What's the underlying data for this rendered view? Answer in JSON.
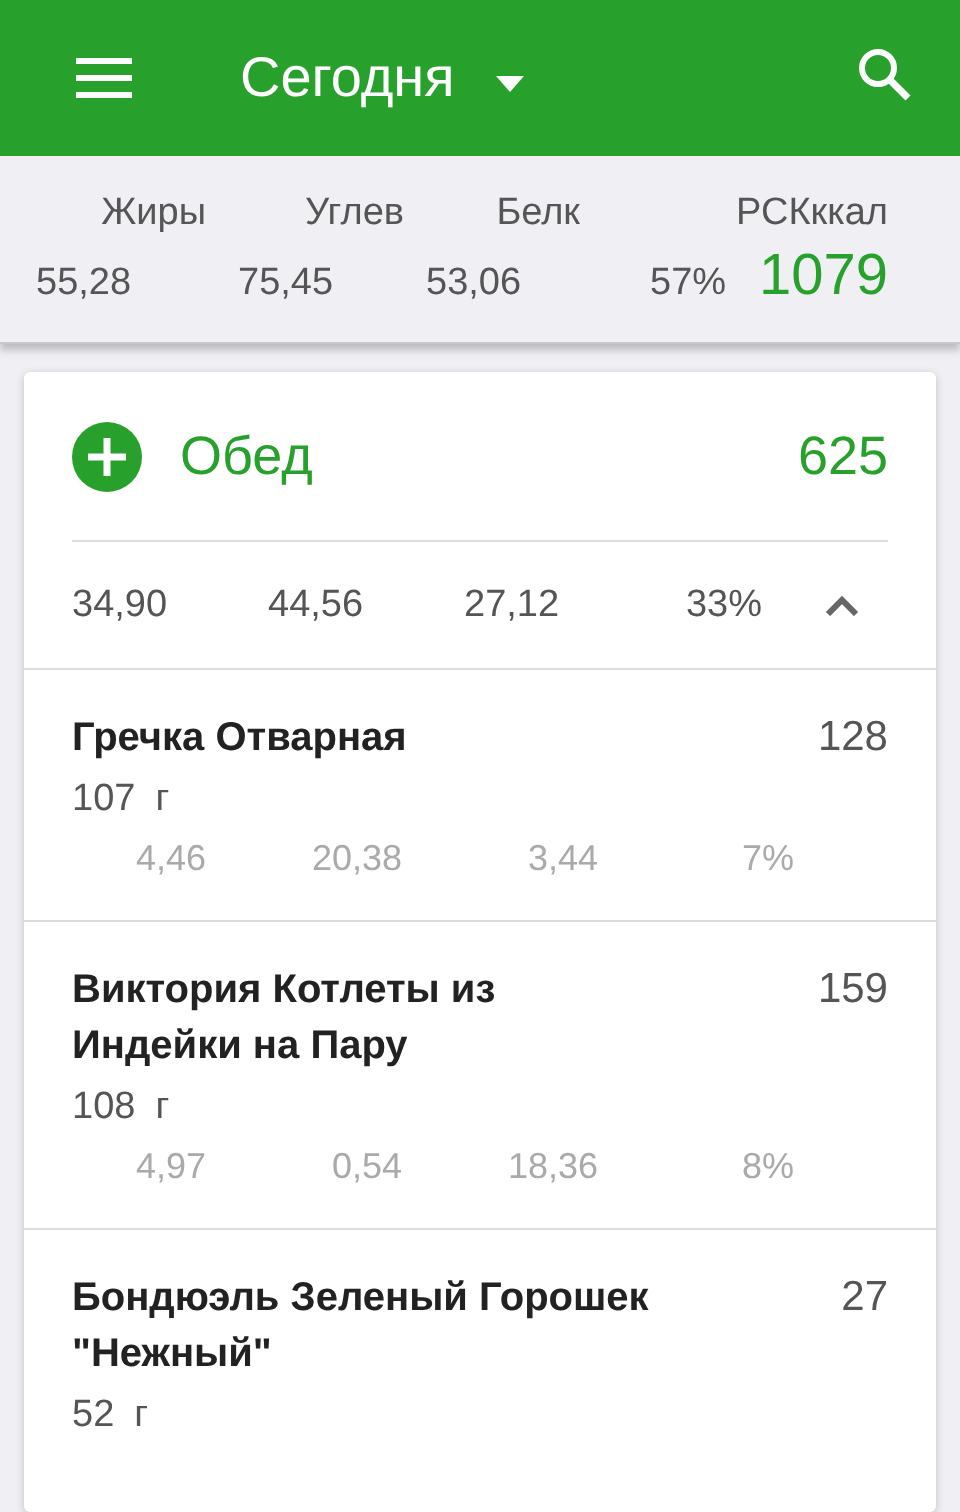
{
  "app_bar": {
    "title": "Сегодня"
  },
  "summary": {
    "labels": [
      "Жиры",
      "Углев",
      "Белк",
      "РСКккал"
    ],
    "values": [
      "55,28",
      "75,45",
      "53,06",
      "57%"
    ],
    "calories": "1079"
  },
  "meal": {
    "name": "Обед",
    "calories": "625",
    "expanded": true,
    "totals": [
      "34,90",
      "44,56",
      "27,12",
      "33%"
    ],
    "items": [
      {
        "name": "Гречка Отварная",
        "calories": "128",
        "amount": "107",
        "unit": "г",
        "macros": [
          "4,46",
          "20,38",
          "3,44",
          "7%"
        ]
      },
      {
        "name": "Виктория Котлеты из Индейки на Пару",
        "calories": "159",
        "amount": "108",
        "unit": "г",
        "macros": [
          "4,97",
          "0,54",
          "18,36",
          "8%"
        ]
      },
      {
        "name": "Бондюэль Зеленый Горошек \"Нежный\"",
        "calories": "27",
        "amount": "52",
        "unit": "г"
      }
    ]
  }
}
